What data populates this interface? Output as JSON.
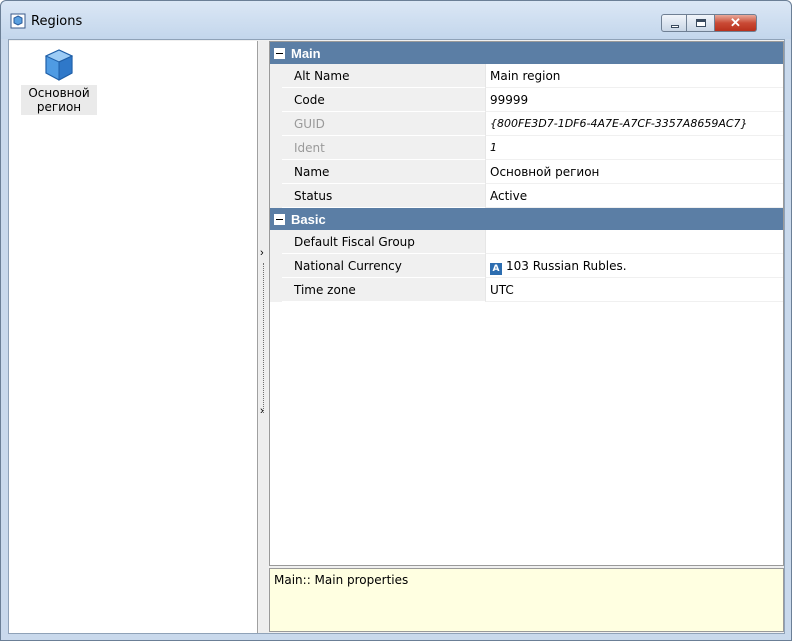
{
  "window": {
    "title": "Regions",
    "icon": "region-cube-icon",
    "controls": [
      "minimize-icon",
      "maximize-icon",
      "close-icon"
    ],
    "close_glyph": "✕"
  },
  "region_list": {
    "items": [
      {
        "label": "Основной регион",
        "icon": "blue-cube-icon"
      }
    ]
  },
  "splitter": {
    "arrow_top": "›",
    "arrow_bottom": "›"
  },
  "property_grid": {
    "categories": [
      {
        "name": "Main",
        "properties": [
          {
            "name": "Alt Name",
            "value": "Main region"
          },
          {
            "name": "Code",
            "value": "99999"
          },
          {
            "name": "GUID",
            "value": "{800FE3D7-1DF6-4A7E-A7CF-3357A8659AC7}",
            "readonly": true
          },
          {
            "name": "Ident",
            "value": "1",
            "readonly": true
          },
          {
            "name": "Name",
            "value": "Основной регион"
          },
          {
            "name": "Status",
            "value": "Active"
          }
        ]
      },
      {
        "name": "Basic",
        "properties": [
          {
            "name": "Default Fiscal Group",
            "value": ""
          },
          {
            "name": "National Currency",
            "value": "103 Russian Rubles.",
            "badge": "A"
          },
          {
            "name": "Time zone",
            "value": "UTC"
          }
        ]
      }
    ]
  },
  "description": {
    "text": "Main:: Main properties"
  },
  "colors": {
    "category_header": "#5b7ea5",
    "description_bg": "#ffffe1",
    "close_button": "#c94a35"
  }
}
